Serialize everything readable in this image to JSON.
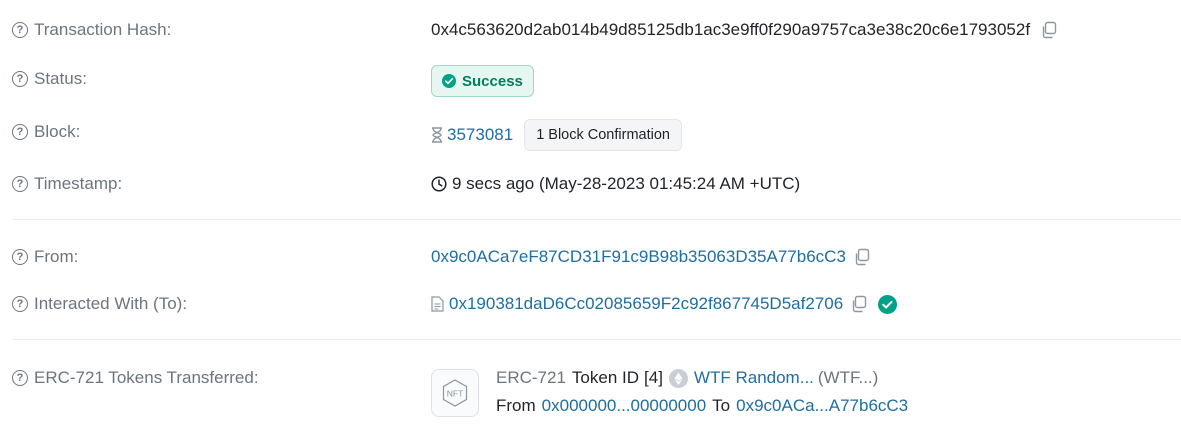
{
  "txhash": {
    "label": "Transaction Hash:",
    "value": "0x4c563620d2ab014b49d85125db1ac3e9ff0f290a9757ca3e38c20c6e1793052f"
  },
  "status": {
    "label": "Status:",
    "value": "Success"
  },
  "block": {
    "label": "Block:",
    "number": "3573081",
    "confirmation": "1 Block Confirmation"
  },
  "timestamp": {
    "label": "Timestamp:",
    "value": "9 secs ago (May-28-2023 01:45:24 AM +UTC)"
  },
  "from": {
    "label": "From:",
    "address": "0x9c0ACa7eF87CD31F91c9B98b35063D35A77b6cC3"
  },
  "to": {
    "label": "Interacted With (To):",
    "address": "0x190381daD6Cc02085659F2c92f867745D5af2706"
  },
  "erc721": {
    "label": "ERC-721 Tokens Transferred:",
    "standard": "ERC-721",
    "token_id_label": "Token ID",
    "token_id": "[4]",
    "token_name": "WTF Random...",
    "token_symbol": "(WTF...)",
    "from_label": "From",
    "from_address": "0x000000...00000000",
    "to_label": "To",
    "to_address": "0x9c0ACa...A77b6cC3",
    "nft_icon_text": "NFT"
  },
  "colors": {
    "link": "#1e6ea0",
    "success": "#00a186",
    "label": "#6c757d"
  }
}
